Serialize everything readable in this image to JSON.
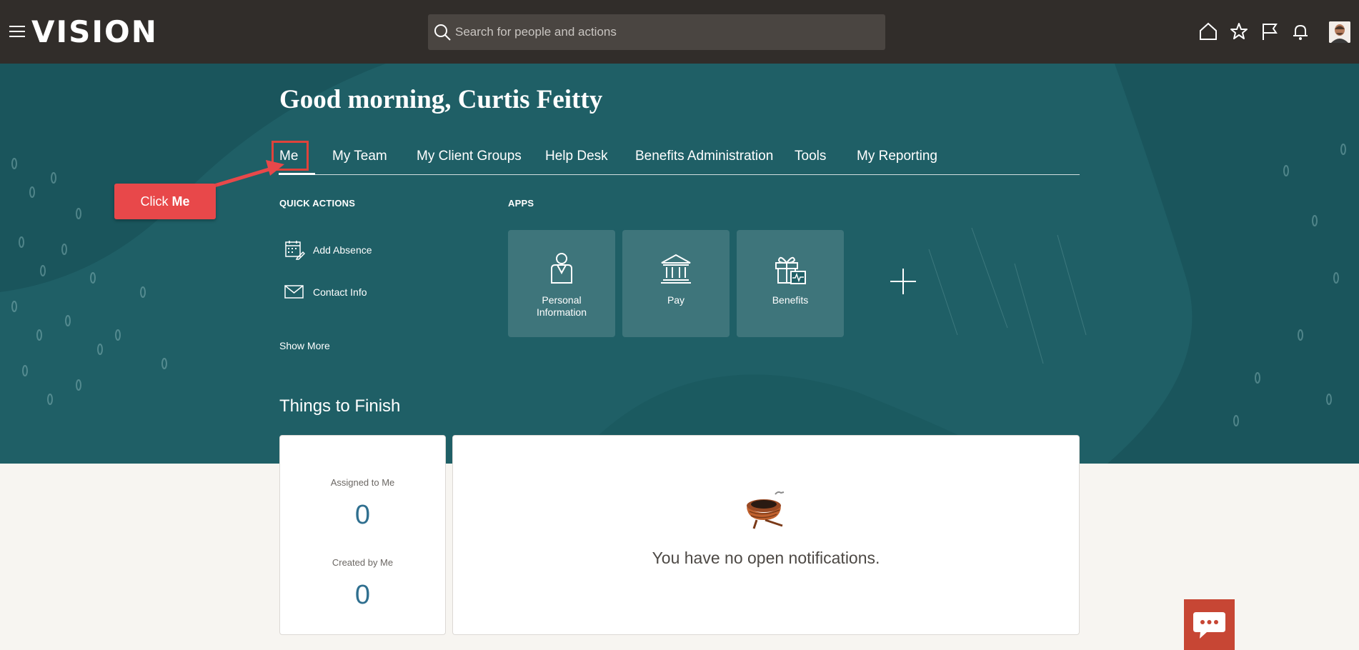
{
  "app": {
    "logo": "VISION"
  },
  "search": {
    "placeholder": "Search for people and actions"
  },
  "header_icons": [
    "home-icon",
    "star-icon",
    "flag-icon",
    "bell-icon"
  ],
  "greeting": "Good morning, Curtis Feitty",
  "tabs": [
    {
      "label": "Me",
      "active": true
    },
    {
      "label": "My Team"
    },
    {
      "label": "My Client Groups"
    },
    {
      "label": "Help Desk"
    },
    {
      "label": "Benefits Administration"
    },
    {
      "label": "Tools"
    },
    {
      "label": "My Reporting"
    }
  ],
  "quick_actions": {
    "title": "QUICK ACTIONS",
    "items": [
      {
        "label": "Add Absence",
        "icon": "calendar-edit-icon"
      },
      {
        "label": "Contact Info",
        "icon": "envelope-icon"
      }
    ],
    "show_more": "Show More"
  },
  "apps": {
    "title": "APPS",
    "tiles": [
      {
        "label": "Personal Information",
        "icon": "person-icon"
      },
      {
        "label": "Pay",
        "icon": "bank-icon"
      },
      {
        "label": "Benefits",
        "icon": "gift-icon"
      }
    ]
  },
  "callout": {
    "prefix": "Click ",
    "target": "Me"
  },
  "things_to_finish": {
    "title": "Things to Finish",
    "assigned_label": "Assigned to Me",
    "assigned_value": "0",
    "created_label": "Created by Me",
    "created_value": "0",
    "empty_message": "You have no open notifications."
  },
  "colors": {
    "topbar": "#312d2a",
    "hero": "#1f5f66",
    "accent_red": "#e8484a",
    "chat": "#c74634",
    "count_blue": "#2f6f8f"
  }
}
